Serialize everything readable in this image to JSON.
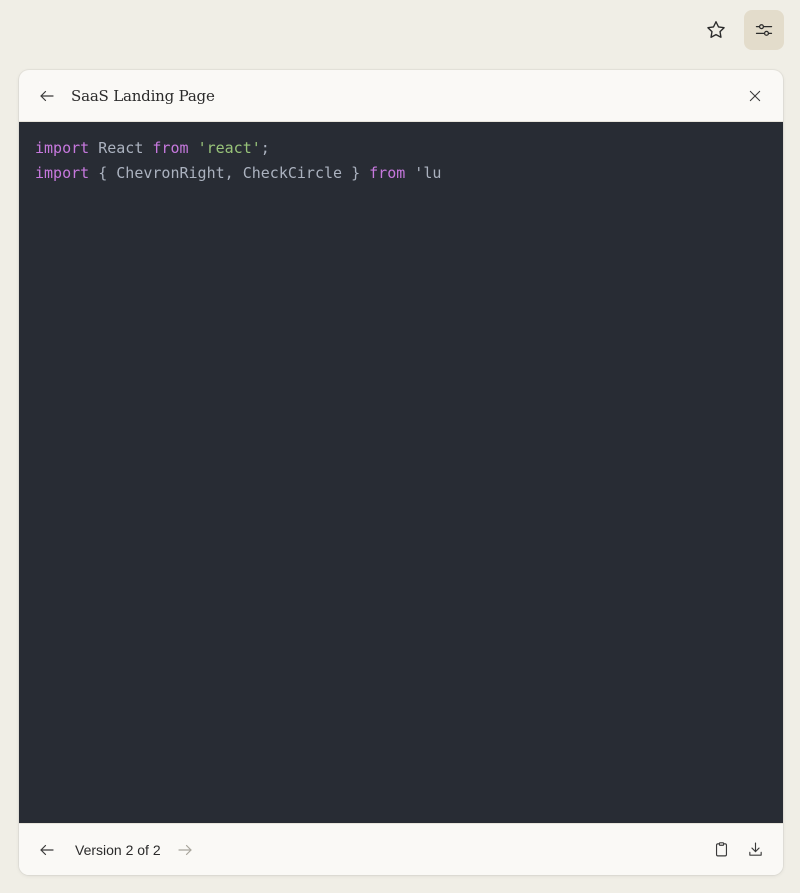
{
  "topbar": {
    "star_icon": "star-icon",
    "settings_icon": "sliders-icon"
  },
  "artifact": {
    "title": "SaaS Landing Page",
    "back_icon": "arrow-left-icon",
    "close_icon": "close-icon",
    "code_lines": [
      [
        {
          "t": "import",
          "c": "kw"
        },
        {
          "t": " React ",
          "c": ""
        },
        {
          "t": "from",
          "c": "kw"
        },
        {
          "t": " ",
          "c": ""
        },
        {
          "t": "'react'",
          "c": "str"
        },
        {
          "t": ";",
          "c": ""
        }
      ],
      [
        {
          "t": "import",
          "c": "kw"
        },
        {
          "t": " { ChevronRight, CheckCircle } ",
          "c": ""
        },
        {
          "t": "from",
          "c": "kw"
        },
        {
          "t": " 'lu",
          "c": ""
        }
      ]
    ],
    "footer": {
      "version_label": "Version 2 of 2",
      "prev_icon": "arrow-left-icon",
      "next_icon": "arrow-right-icon",
      "copy_icon": "clipboard-icon",
      "download_icon": "download-icon"
    }
  },
  "colors": {
    "background": "#f0eee6",
    "code_bg": "#282c34",
    "keyword": "#c678dd",
    "string": "#98c379",
    "plain": "#abb2bf"
  }
}
